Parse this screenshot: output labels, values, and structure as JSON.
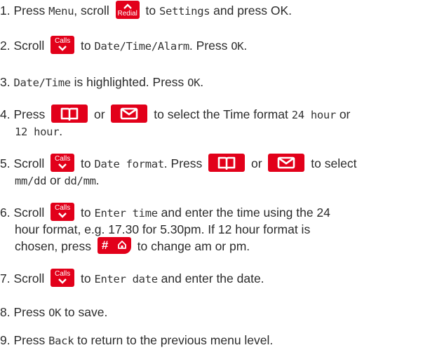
{
  "steps": [
    {
      "n": "1.",
      "t1": "Press ",
      "m1": "Menu",
      "t2": ", scroll ",
      "key": "Redial",
      "t3": " to ",
      "m2": "Settings",
      "t4": " and press OK."
    },
    {
      "n": "2.",
      "t1": "Scroll ",
      "key": "Calls",
      "t2": " to ",
      "m1": "Date/Time/Alarm",
      "t3": ". Press ",
      "m2": "OK",
      "t4": "."
    },
    {
      "n": "3.",
      "m1": "Date/Time",
      "t1": " is highlighted. Press ",
      "m2": "OK",
      "t2": "."
    },
    {
      "n": "4.",
      "t1": "Press ",
      "t2": " or ",
      "t3": " to select the Time format ",
      "m1": "24 hour",
      "t4": " or",
      "l2": "12 hour",
      "l2b": "."
    },
    {
      "n": "5.",
      "t1": "Scroll ",
      "key": "Calls",
      "t2": " to ",
      "m1": "Date format",
      "t3": ". Press ",
      "t4": " or ",
      "t5": " to select",
      "l2a": "mm/dd",
      "l2b": " or ",
      "l2c": "dd/mm",
      "l2d": "."
    },
    {
      "n": "6.",
      "t1": "Scroll ",
      "key": "Calls",
      "t2": " to ",
      "m1": "Enter time",
      "t3": " and enter the time using the 24",
      "l2": "hour format, e.g. 17.30 for 5.30pm. If 12 hour format is",
      "l3a": "chosen, press ",
      "l3b": " to change am or pm."
    },
    {
      "n": "7.",
      "t1": "Scroll ",
      "key": "Calls",
      "t2": " to ",
      "m1": "Enter date",
      "t3": " and enter the date."
    },
    {
      "n": "8.",
      "t1": "Press ",
      "m1": "OK",
      "t2": " to save."
    },
    {
      "n": "9.",
      "t1": "Press ",
      "m1": "Back",
      "t2": " to return to the previous menu level."
    }
  ],
  "colors": {
    "key_bg": "#e2001a",
    "text": "#2b2b2b"
  },
  "icons": [
    "chevron-up-icon",
    "chevron-down-icon",
    "phonebook-icon",
    "envelope-icon",
    "hash-key-icon"
  ]
}
